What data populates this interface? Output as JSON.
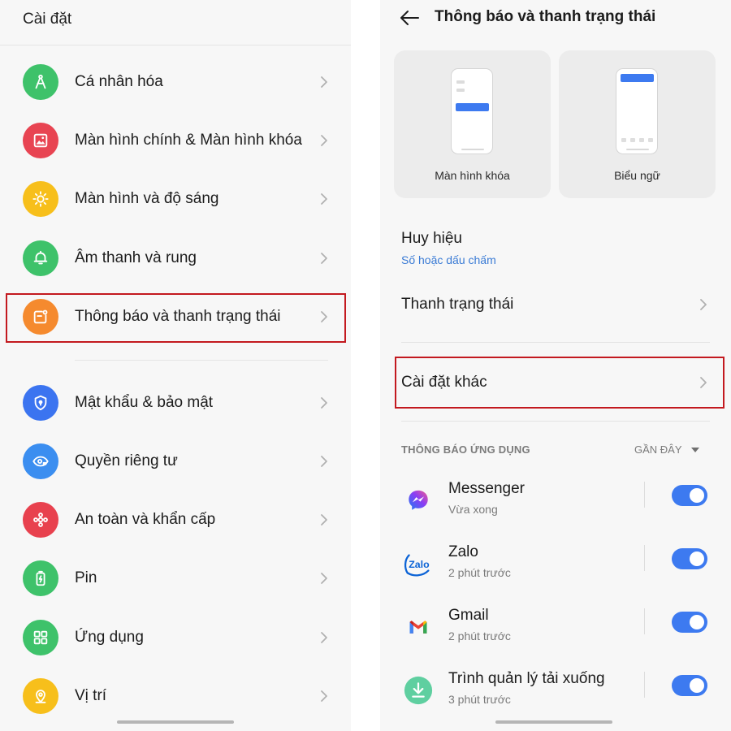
{
  "left": {
    "title": "Cài đặt",
    "items": [
      {
        "label": "Cá nhân hóa",
        "icon": "personalization-icon",
        "color": "#3ec26a"
      },
      {
        "label": "Màn hình chính & Màn hình khóa",
        "icon": "wallpaper-icon",
        "color": "#e84452"
      },
      {
        "label": "Màn hình và độ sáng",
        "icon": "brightness-icon",
        "color": "#f7bf1b"
      },
      {
        "label": "Âm thanh và rung",
        "icon": "bell-icon",
        "color": "#3ec26a"
      },
      {
        "label": "Thông báo và thanh trạng thái",
        "icon": "notification-icon",
        "color": "#f58a2e",
        "highlighted": true
      },
      {
        "label": "Mật khẩu & bảo mật",
        "icon": "shield-icon",
        "color": "#3b74f0"
      },
      {
        "label": "Quyền riêng tư",
        "icon": "privacy-eye-icon",
        "color": "#3b8ef0"
      },
      {
        "label": "An toàn và khẩn cấp",
        "icon": "emergency-icon",
        "color": "#e8414e"
      },
      {
        "label": "Pin",
        "icon": "battery-icon",
        "color": "#3ec26a"
      },
      {
        "label": "Ứng dụng",
        "icon": "apps-grid-icon",
        "color": "#3ec26a"
      },
      {
        "label": "Vị trí",
        "icon": "location-icon",
        "color": "#f7bf1b"
      }
    ]
  },
  "right": {
    "title": "Thông báo và thanh trạng thái",
    "styles": [
      {
        "label": "Màn hình khóa"
      },
      {
        "label": "Biểu ngữ"
      }
    ],
    "badge": {
      "title": "Huy hiệu",
      "value": "Số hoặc dấu chấm"
    },
    "status_bar": {
      "title": "Thanh trạng thái"
    },
    "other_settings": {
      "title": "Cài đặt khác"
    },
    "apps_section": {
      "label": "THÔNG BÁO ỨNG DỤNG",
      "sort": "GẦN ĐÂY",
      "apps": [
        {
          "name": "Messenger",
          "time": "Vừa xong",
          "enabled": true
        },
        {
          "name": "Zalo",
          "time": "2 phút trước",
          "enabled": true,
          "icon_text": "Zalo"
        },
        {
          "name": "Gmail",
          "time": "2 phút trước",
          "enabled": true
        },
        {
          "name": "Trình quản lý tải xuống",
          "time": "3 phút trước",
          "enabled": true
        }
      ]
    }
  },
  "colors": {
    "accent": "#3d7af0",
    "highlight_border": "#c3191f"
  }
}
